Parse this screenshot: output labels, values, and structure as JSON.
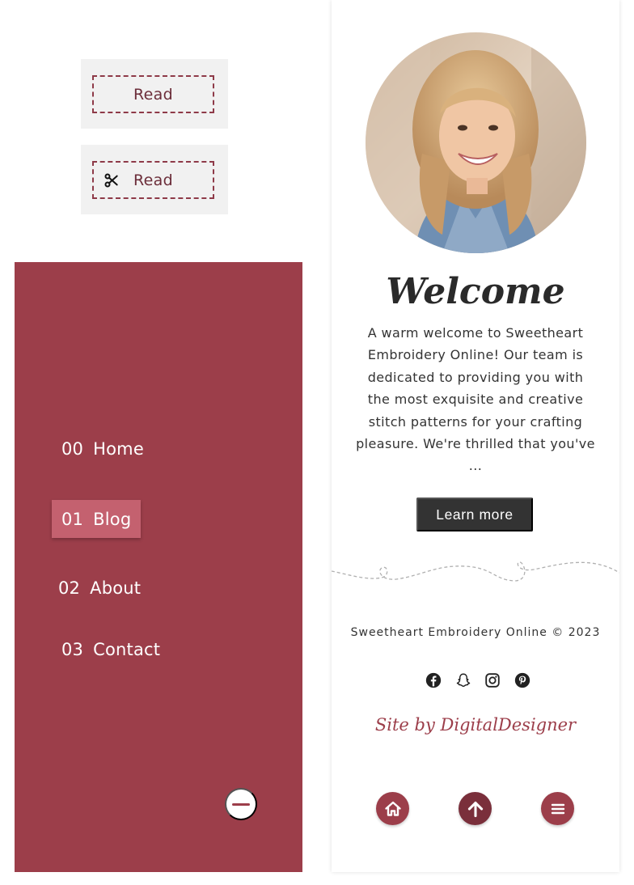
{
  "read_buttons": [
    {
      "label": "Read",
      "icon": "none"
    },
    {
      "label": "Read",
      "icon": "scissors-icon"
    }
  ],
  "menu": {
    "items": [
      {
        "number": "00",
        "label": "Home",
        "active": false
      },
      {
        "number": "01",
        "label": "Blog",
        "active": true
      },
      {
        "number": "02",
        "label": "About",
        "active": false
      },
      {
        "number": "03",
        "label": "Contact",
        "active": false
      }
    ],
    "close_icon": "minus-icon"
  },
  "phone": {
    "welcome_title": "Welcome",
    "intro_text": "A warm welcome to Sweetheart Embroidery Online! Our team is dedicated to providing you with the most exquisite and creative stitch patterns for your crafting pleasure. We're thrilled that you've ...",
    "learn_more_label": "Learn more",
    "copyright": "Sweetheart Embroidery Online ©  2023",
    "social_icons": [
      "facebook-icon",
      "snapchat-icon",
      "instagram-icon",
      "pinterest-icon"
    ],
    "credit": "Site by DigitalDesigner",
    "bottom_nav": [
      "home-icon",
      "arrow-up-icon",
      "hamburger-menu-icon"
    ]
  },
  "colors": {
    "brand": "#9c3e4a",
    "brand_active": "#c4616f",
    "dark_button": "#333333",
    "read_box_bg": "#f1f1f1",
    "dashed_border": "#8e3a48",
    "scroll_top_bg": "#7a2f3b"
  }
}
